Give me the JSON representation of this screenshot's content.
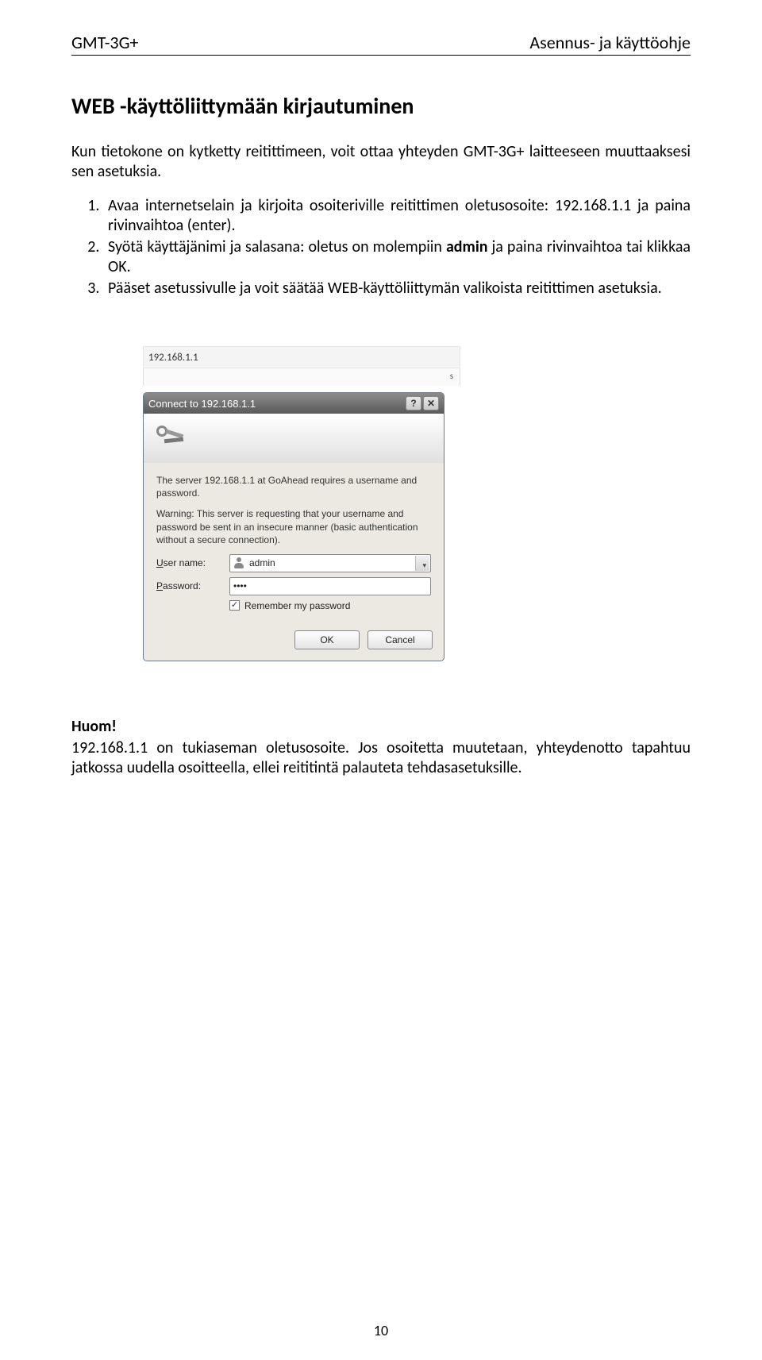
{
  "header": {
    "left": "GMT-3G+",
    "right": "Asennus- ja käyttöohje"
  },
  "section_title": "WEB -käyttöliittymään kirjautuminen",
  "intro": "Kun tietokone on kytketty reitittimeen, voit ottaa yhteyden GMT-3G+ laitteeseen muuttaaksesi sen asetuksia.",
  "steps": {
    "s1a": "Avaa internetselain ja kirjoita osoiteriville reitittimen oletusosoite: 192.168.1.1 ja paina rivinvaihtoa (enter).",
    "s2a": "Syötä käyttäjänimi ja salasana: oletus on molempiin ",
    "s2b": "admin",
    "s2c": " ja paina rivinvaihtoa tai klikkaa OK.",
    "s3a": "Pääset asetussivulle ja voit säätää WEB-käyttöliittymän valikoista reitittimen asetuksia."
  },
  "dialog": {
    "address_bar": "192.168.1.1",
    "title": "Connect to 192.168.1.1",
    "help_glyph": "?",
    "close_glyph": "✕",
    "msg1": "The server 192.168.1.1 at GoAhead requires a username and password.",
    "msg2": "Warning: This server is requesting that your username and password be sent in an insecure manner (basic authentication without a secure connection).",
    "username_label_pre": "U",
    "username_label_post": "ser name:",
    "password_label_pre": "P",
    "password_label_post": "assword:",
    "username_value": "admin",
    "password_value": "••••",
    "remember_check": "✓",
    "remember_label": "Remember my password",
    "ok": "OK",
    "cancel": "Cancel"
  },
  "note": {
    "title": "Huom!",
    "text": "192.168.1.1 on tukiaseman oletusosoite. Jos osoitetta muutetaan, yhteydenotto tapahtuu jatkossa uudella osoitteella, ellei reititintä palauteta tehdasasetuksille."
  },
  "page_number": "10"
}
